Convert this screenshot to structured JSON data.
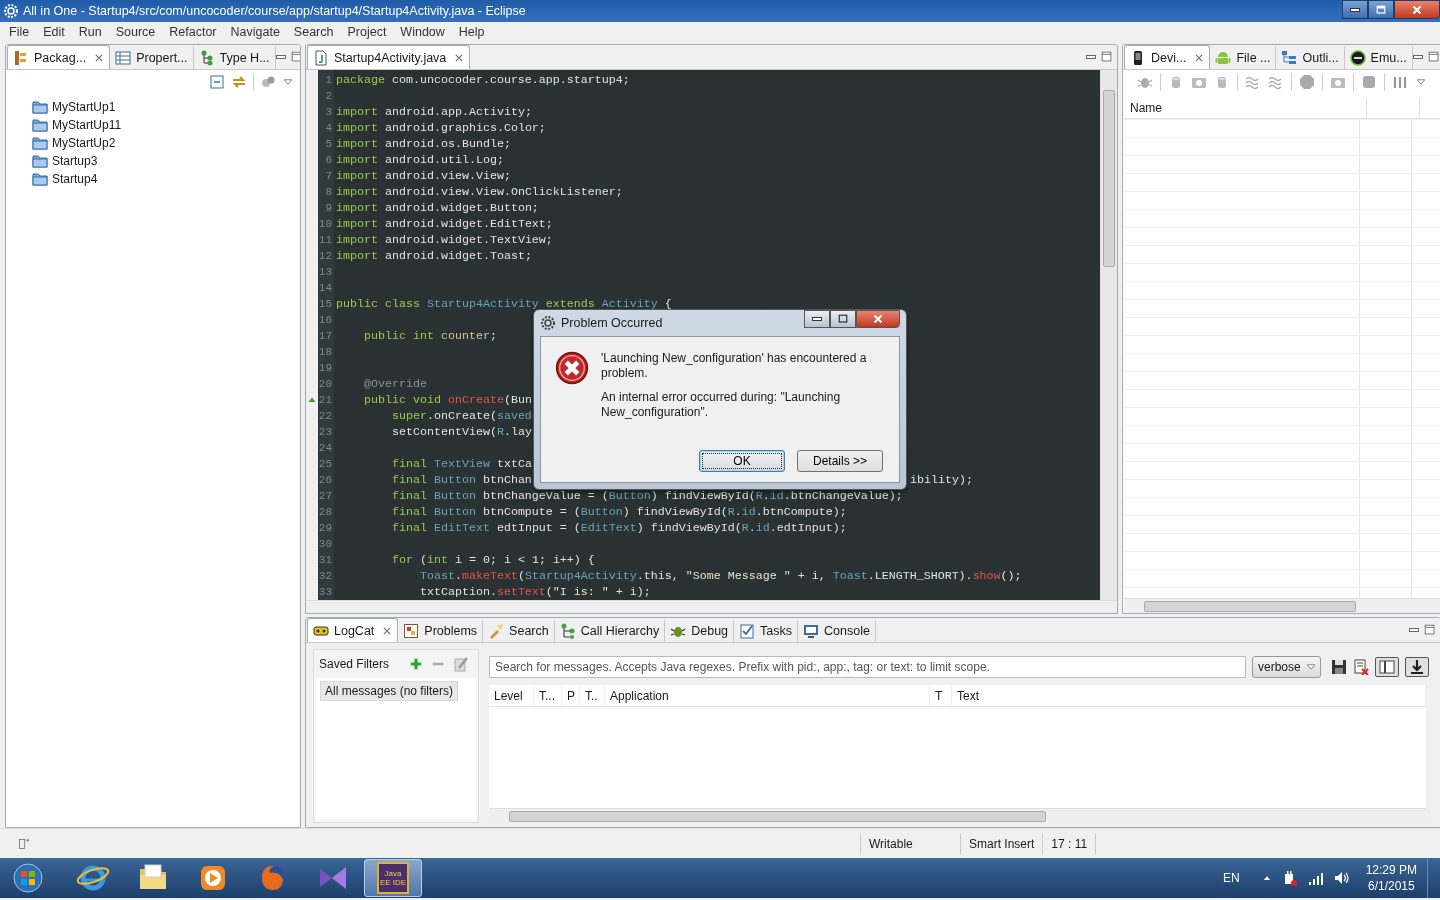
{
  "window": {
    "title": "All in One - Startup4/src/com/uncocoder/course/app/startup4/Startup4Activity.java - Eclipse"
  },
  "menu": [
    "File",
    "Edit",
    "Run",
    "Source",
    "Refactor",
    "Navigate",
    "Search",
    "Project",
    "Window",
    "Help"
  ],
  "left_panel": {
    "tabs": [
      {
        "label": "Packag...",
        "selected": true,
        "closable": true
      },
      {
        "label": "Propert...",
        "selected": false,
        "closable": false
      },
      {
        "label": "Type H...",
        "selected": false,
        "closable": false
      }
    ],
    "tree": [
      {
        "label": "MyStartUp1"
      },
      {
        "label": "MyStartUp11"
      },
      {
        "label": "MyStartUp2"
      },
      {
        "label": "Startup3"
      },
      {
        "label": "Startup4"
      }
    ]
  },
  "editor": {
    "tabs": [
      {
        "label": "Startup4Activity.java",
        "selected": true
      }
    ],
    "lines": [
      {
        "n": "1",
        "tokens": [
          {
            "kind": "kw",
            "text": "package"
          },
          {
            "kind": "pl",
            "text": " com.uncocoder.course.app.startup4;"
          }
        ]
      },
      {
        "n": "2"
      },
      {
        "n": "3",
        "tokens": [
          {
            "kind": "kw",
            "text": "import"
          },
          {
            "kind": "pl",
            "text": " android.app.Activity;"
          }
        ]
      },
      {
        "n": "4",
        "tokens": [
          {
            "kind": "kw",
            "text": "import"
          },
          {
            "kind": "pl",
            "text": " android.graphics.Color;"
          }
        ]
      },
      {
        "n": "5",
        "tokens": [
          {
            "kind": "kw",
            "text": "import"
          },
          {
            "kind": "pl",
            "text": " android.os.Bundle;"
          }
        ]
      },
      {
        "n": "6",
        "tokens": [
          {
            "kind": "kw",
            "text": "import"
          },
          {
            "kind": "pl",
            "text": " android.util.Log;"
          }
        ]
      },
      {
        "n": "7",
        "tokens": [
          {
            "kind": "kw",
            "text": "import"
          },
          {
            "kind": "pl",
            "text": " android.view.View;"
          }
        ]
      },
      {
        "n": "8",
        "tokens": [
          {
            "kind": "kw",
            "text": "import"
          },
          {
            "kind": "pl",
            "text": " android.view.View.OnClickListener;"
          }
        ]
      },
      {
        "n": "9",
        "tokens": [
          {
            "kind": "kw",
            "text": "import"
          },
          {
            "kind": "pl",
            "text": " android.widget.Button;"
          }
        ]
      },
      {
        "n": "10",
        "tokens": [
          {
            "kind": "kw",
            "text": "import"
          },
          {
            "kind": "pl",
            "text": " android.widget.EditText;"
          }
        ]
      },
      {
        "n": "11",
        "tokens": [
          {
            "kind": "kw",
            "text": "import"
          },
          {
            "kind": "pl",
            "text": " android.widget.TextView;"
          }
        ]
      },
      {
        "n": "12",
        "tokens": [
          {
            "kind": "kw",
            "text": "import"
          },
          {
            "kind": "pl",
            "text": " android.widget.Toast;"
          }
        ]
      },
      {
        "n": "13"
      },
      {
        "n": "14"
      },
      {
        "n": "15",
        "tokens": [
          {
            "kind": "kw",
            "text": "public class"
          },
          {
            "kind": "ty",
            "text": " Startup4Activity"
          },
          {
            "kind": "kw",
            "text": " extends"
          },
          {
            "kind": "ty",
            "text": " Activity"
          },
          {
            "kind": "pl",
            "text": " {"
          }
        ]
      },
      {
        "n": "16"
      },
      {
        "n": "17",
        "tokens": [
          {
            "kind": "kw",
            "text": "    public int"
          },
          {
            "kind": "fd",
            "text": " counter"
          },
          {
            "kind": "pl",
            "text": ";"
          }
        ]
      },
      {
        "n": "18"
      },
      {
        "n": "19"
      },
      {
        "n": "20",
        "tokens": [
          {
            "kind": "an",
            "text": "    @Override"
          }
        ]
      },
      {
        "n": "21",
        "override": true,
        "tokens": [
          {
            "kind": "kw",
            "text": "    public void"
          },
          {
            "kind": "me",
            "text": " onCreate"
          },
          {
            "kind": "pl",
            "text": "(Bun"
          }
        ]
      },
      {
        "n": "22",
        "tokens": [
          {
            "kind": "kw",
            "text": "        super"
          },
          {
            "kind": "pl",
            "text": ".onCreate("
          },
          {
            "kind": "ty",
            "text": "saved"
          }
        ]
      },
      {
        "n": "23",
        "tokens": [
          {
            "kind": "pl",
            "text": "        setContentView("
          },
          {
            "kind": "ty",
            "text": "R"
          },
          {
            "kind": "pl",
            "text": ".lay"
          }
        ]
      },
      {
        "n": "24"
      },
      {
        "n": "25",
        "tokens": [
          {
            "kind": "kw",
            "text": "        final"
          },
          {
            "kind": "ty",
            "text": " TextView"
          },
          {
            "kind": "pl",
            "text": " txtCa"
          }
        ]
      },
      {
        "n": "26",
        "tokens": [
          {
            "kind": "kw",
            "text": "        final"
          },
          {
            "kind": "ty",
            "text": " Button"
          },
          {
            "kind": "pl",
            "text": " btnChan"
          }
        ],
        "tail": "ibility);"
      },
      {
        "n": "27",
        "tokens": [
          {
            "kind": "kw",
            "text": "        final"
          },
          {
            "kind": "ty",
            "text": " Button"
          },
          {
            "kind": "pl",
            "text": " btnChangeValue = ("
          },
          {
            "kind": "ty",
            "text": "Button"
          },
          {
            "kind": "pl",
            "text": ") findViewById("
          },
          {
            "kind": "ty",
            "text": "R"
          },
          {
            "kind": "pl",
            "text": "."
          },
          {
            "kind": "ty",
            "text": "id"
          },
          {
            "kind": "pl",
            "text": ".btnChangeValue);"
          }
        ]
      },
      {
        "n": "28",
        "tokens": [
          {
            "kind": "kw",
            "text": "        final"
          },
          {
            "kind": "ty",
            "text": " Button"
          },
          {
            "kind": "pl",
            "text": " btnCompute = ("
          },
          {
            "kind": "ty",
            "text": "Button"
          },
          {
            "kind": "pl",
            "text": ") findViewById("
          },
          {
            "kind": "ty",
            "text": "R"
          },
          {
            "kind": "pl",
            "text": "."
          },
          {
            "kind": "ty",
            "text": "id"
          },
          {
            "kind": "pl",
            "text": ".btnCompute);"
          }
        ]
      },
      {
        "n": "29",
        "tokens": [
          {
            "kind": "kw",
            "text": "        final"
          },
          {
            "kind": "ty",
            "text": " EditText"
          },
          {
            "kind": "pl",
            "text": " edtInput = ("
          },
          {
            "kind": "ty",
            "text": "EditText"
          },
          {
            "kind": "pl",
            "text": ") findViewById("
          },
          {
            "kind": "ty",
            "text": "R"
          },
          {
            "kind": "pl",
            "text": "."
          },
          {
            "kind": "ty",
            "text": "id"
          },
          {
            "kind": "pl",
            "text": ".edtInput);"
          }
        ]
      },
      {
        "n": "30"
      },
      {
        "n": "31",
        "tokens": [
          {
            "kind": "kw",
            "text": "        for"
          },
          {
            "kind": "pl",
            "text": " ("
          },
          {
            "kind": "kw",
            "text": "int"
          },
          {
            "kind": "pl",
            "text": " i = 0; i < 1; i++) {"
          }
        ]
      },
      {
        "n": "32",
        "tokens": [
          {
            "kind": "ty",
            "text": "            Toast"
          },
          {
            "kind": "pl",
            "text": "."
          },
          {
            "kind": "me",
            "text": "makeText"
          },
          {
            "kind": "pl",
            "text": "("
          },
          {
            "kind": "ty",
            "text": "Startup4Activity"
          },
          {
            "kind": "pl",
            "text": ".this, "
          },
          {
            "kind": "st",
            "text": "\"Some Message \""
          },
          {
            "kind": "pl",
            "text": " + i, "
          },
          {
            "kind": "ty",
            "text": "Toast"
          },
          {
            "kind": "pl",
            "text": ".LENGTH_SHORT)."
          },
          {
            "kind": "me",
            "text": "show"
          },
          {
            "kind": "pl",
            "text": "();"
          }
        ]
      },
      {
        "n": "33",
        "tokens": [
          {
            "kind": "pl",
            "text": "            txtCaption."
          },
          {
            "kind": "me",
            "text": "setText"
          },
          {
            "kind": "pl",
            "text": "("
          },
          {
            "kind": "st",
            "text": "\"I is: \""
          },
          {
            "kind": "pl",
            "text": " + i);"
          }
        ]
      }
    ]
  },
  "right_panel": {
    "tabs": [
      {
        "label": "Devi...",
        "selected": true,
        "closable": true
      },
      {
        "label": "File ...",
        "selected": false,
        "closable": false
      },
      {
        "label": "Outli...",
        "selected": false,
        "closable": false
      },
      {
        "label": "Emu...",
        "selected": false,
        "closable": false
      }
    ],
    "columns": [
      "Name"
    ]
  },
  "dialog": {
    "title": "Problem Occurred",
    "message": "'Launching New_configuration' has encountered a problem.",
    "detail": "An internal error occurred during: \"Launching New_configuration\".",
    "buttons": [
      {
        "label": "OK",
        "focused": true
      },
      {
        "label": "Details >>",
        "focused": false
      }
    ]
  },
  "bottom_panel": {
    "tabs": [
      {
        "label": "LogCat",
        "selected": true,
        "closable": true
      },
      {
        "label": "Problems",
        "selected": false,
        "closable": false
      },
      {
        "label": "Search",
        "selected": false,
        "closable": false
      },
      {
        "label": "Call Hierarchy",
        "selected": false,
        "closable": false
      },
      {
        "label": "Debug",
        "selected": false,
        "closable": false
      },
      {
        "label": "Tasks",
        "selected": false,
        "closable": false
      },
      {
        "label": "Console",
        "selected": false,
        "closable": false
      }
    ],
    "saved_filters": {
      "title": "Saved Filters",
      "items": [
        {
          "label": "All messages (no filters)",
          "selected": true
        }
      ]
    },
    "search": {
      "placeholder": "Search for messages. Accepts Java regexes. Prefix with pid:, app:, tag: or text: to limit scope."
    },
    "level_select": {
      "value": "verbose"
    },
    "columns": [
      "Level",
      "T...",
      "P",
      "T..",
      "Application",
      "T",
      "Text"
    ]
  },
  "status_bar": {
    "fields": [
      "Writable",
      "Smart Insert",
      "17 : 11"
    ]
  },
  "taskbar": {
    "apps": [
      {
        "kind": "browser",
        "selected": false
      },
      {
        "kind": "folder",
        "selected": false
      },
      {
        "kind": "media",
        "selected": false
      },
      {
        "kind": "firefox",
        "selected": false
      },
      {
        "kind": "studio",
        "selected": false
      },
      {
        "kind": "ide",
        "label": "Java EE IDE",
        "selected": true
      }
    ],
    "tray": {
      "language": "EN",
      "time": "12:29 PM",
      "date": "6/1/2015"
    }
  }
}
